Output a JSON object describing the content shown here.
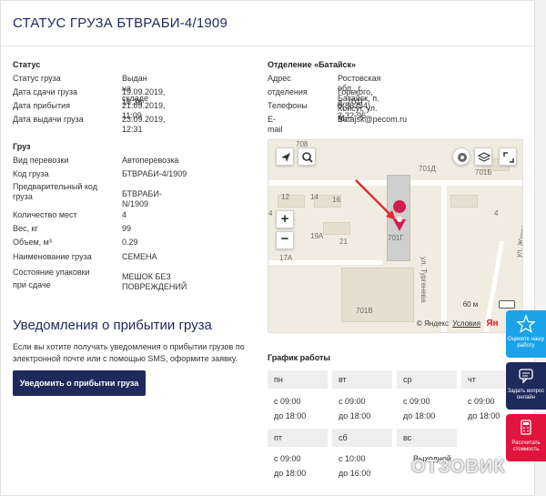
{
  "page": {
    "title": "СТАТУС ГРУЗА БТВРАБИ-4/1909"
  },
  "status": {
    "heading": "Статус",
    "rows": [
      {
        "label": "Статус груза",
        "value": "Выдан на складе"
      },
      {
        "label": "Дата сдачи груза",
        "value": "19.09.2019, 16:36"
      },
      {
        "label": "Дата прибытия",
        "value": "21.09.2019, 11:09"
      },
      {
        "label": "Дата выдачи груза",
        "value": "23.09.2019, 12:31"
      }
    ]
  },
  "cargo": {
    "heading": "Груз",
    "rows": [
      {
        "label": "Вид перевозки",
        "value": "Автоперевозка"
      },
      {
        "label": "Код груза",
        "value": "БТВРАБИ-4/1909"
      },
      {
        "label": "Предварительный код груза",
        "value": "БТВРАБИ-N/1909"
      },
      {
        "label": "Количество мест",
        "value": "4"
      },
      {
        "label": "Вес, кг",
        "value": "99"
      },
      {
        "label": "Объем, м³",
        "value": "0.29"
      },
      {
        "label": "Наименование груза",
        "value": "СЕМЕНА"
      },
      {
        "label": "Состояние упаковки при сдаче",
        "value": "МЕШОК БЕЗ ПОВРЕЖДЕНИЙ"
      }
    ]
  },
  "branch": {
    "heading": "Отделение «Батайск»",
    "address_label": "Адрес отделения",
    "address_label_1": "Адрес",
    "address_label_2": "отделения",
    "address_1": "Ростовская обл., г. Батайск, п. Койсуг, ул. М.",
    "address_2": "Горького, д. 701Г",
    "phone_label": "Телефоны",
    "phone": "8(86354) 2-32-96",
    "email_label": "E-mail",
    "email": "Batajsk@pecom.ru"
  },
  "map": {
    "labels": [
      "708",
      "701Д",
      "701Б",
      "12",
      "14",
      "16",
      "4",
      "19А",
      "21",
      "17А",
      "701Г",
      "701В",
      "ул. Тургенева",
      "ул. Жуковского",
      "60 м",
      "4"
    ],
    "scale": "60 м",
    "copyright": "© Яндекс",
    "terms": "Условия",
    "brand": "Ян"
  },
  "notify": {
    "title": "Уведомления о прибытии груза",
    "text": "Если вы хотите получать уведомления о прибытии грузов по электронной почте или с помощью SMS, оформите заявку.",
    "button": "Уведомить о прибытии груза"
  },
  "schedule": {
    "heading": "График работы",
    "days": [
      {
        "day": "пн",
        "from": "с 09:00",
        "to": "до 18:00"
      },
      {
        "day": "вт",
        "from": "с 09:00",
        "to": "до 18:00"
      },
      {
        "day": "ср",
        "from": "с 09:00",
        "to": "до 18:00"
      },
      {
        "day": "чт",
        "from": "с 09:00",
        "to": "до 18:00"
      },
      {
        "day": "пт",
        "from": "с 09:00",
        "to": "до 18:00"
      },
      {
        "day": "сб",
        "from": "с 10:00",
        "to": "до 16:00"
      },
      {
        "day": "вс",
        "from": "Выходной",
        "to": ""
      }
    ]
  },
  "side": {
    "rate": "Оцените нашу работу",
    "ask": "Задать вопрос онлайн",
    "calc": "Рассчитать стоимость"
  },
  "watermark": "ОТЗОВИК",
  "colors": {
    "accent": "#1e2a5a",
    "side_blue": "#1aa3e8",
    "side_navy": "#1e2a5a",
    "side_red": "#e0143c",
    "pin": "#d11d4f"
  }
}
